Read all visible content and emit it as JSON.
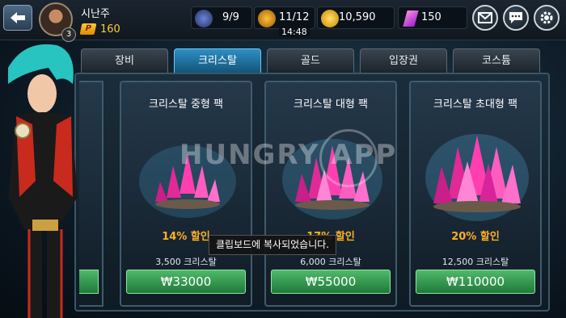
{
  "header": {
    "player_name": "시난주",
    "level": "3",
    "points_icon_letter": "P",
    "points": "160",
    "resources": [
      {
        "icon": "energy-icon",
        "value": "9/9"
      },
      {
        "icon": "stamina-icon",
        "value": "11/12"
      },
      {
        "icon": "gold-coin-icon",
        "value": "10,590"
      },
      {
        "icon": "crystal-icon",
        "value": "150"
      }
    ],
    "timer": "14:48"
  },
  "tabs": [
    {
      "label": "장비"
    },
    {
      "label": "크리스탈",
      "active": true
    },
    {
      "label": "골드"
    },
    {
      "label": "입장권"
    },
    {
      "label": "코스튬"
    }
  ],
  "products": [
    {
      "title": "크리스탈 중형 팩",
      "discount": "14% 할인",
      "amount": "3,500 크리스탈",
      "price": "₩33000"
    },
    {
      "title": "크리스탈 대형 팩",
      "discount": "17% 할인",
      "amount": "6,000 크리스탈",
      "price": "₩55000"
    },
    {
      "title": "크리스탈 초대형 팩",
      "discount": "20% 할인",
      "amount": "12,500 크리스탈",
      "price": "₩110000"
    }
  ],
  "watermark": "HUNGRY APP",
  "toast": "클립보드에 복사되었습니다.",
  "colors": {
    "accent": "#2d8fc4",
    "buy": "#2f9a4c",
    "discount": "#ffb022",
    "crystal": "#ff3fb0"
  }
}
